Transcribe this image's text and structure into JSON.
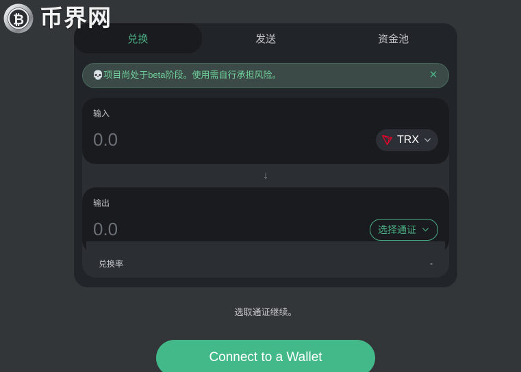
{
  "site": {
    "logo_text": "币界网",
    "logo_icon": "bitcoin-coin-icon"
  },
  "tabs": [
    {
      "label": "兑换",
      "active": true
    },
    {
      "label": "发送",
      "active": false
    },
    {
      "label": "资金池",
      "active": false
    }
  ],
  "alert": {
    "icon": "skull-icon",
    "icon_glyph": "💀",
    "text": "项目尚处于beta阶段。使用需自行承担风险。",
    "close_label": "✕"
  },
  "input_panel": {
    "label": "输入",
    "amount_value": "0.0",
    "amount_placeholder": "0.0",
    "token": {
      "symbol": "TRX",
      "icon": "tron-logo-icon",
      "chevron": "chevron-down-icon"
    }
  },
  "swap_arrow": {
    "glyph": "↓",
    "name": "swap-direction-arrow"
  },
  "output_panel": {
    "label": "输出",
    "amount_value": "0.0",
    "amount_placeholder": "0.0",
    "select_token_label": "选择通证",
    "chevron": "chevron-down-icon"
  },
  "rate": {
    "label": "兑换率",
    "value": "-"
  },
  "footer": {
    "hint": "选取通证继续。",
    "connect_label": "Connect to a Wallet"
  },
  "colors": {
    "page_bg": "#333639",
    "card_bg": "#212429",
    "panel_bg": "#191b1f",
    "accent_green": "#43b989",
    "accent_green_text": "#4caf84",
    "alert_bg": "#3b4a46",
    "alert_text": "#6fcf9b",
    "tron_red": "#eb0029",
    "muted_text": "#c3c5cb",
    "placeholder_text": "#6b6f76"
  }
}
